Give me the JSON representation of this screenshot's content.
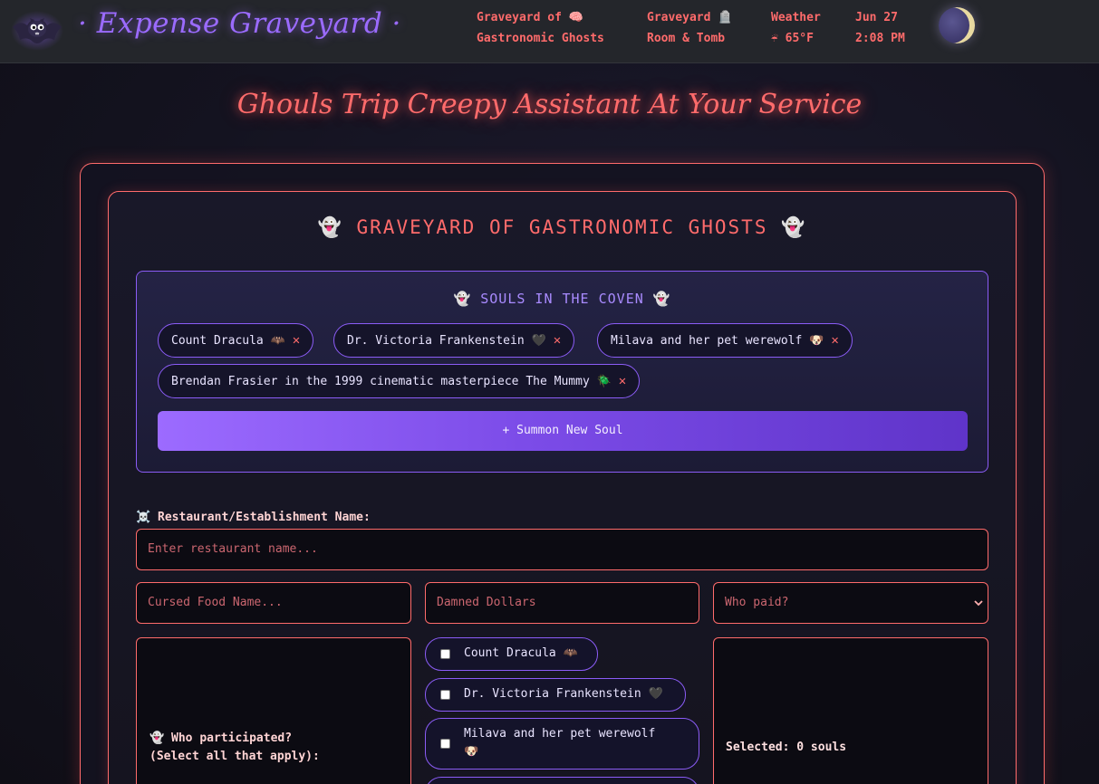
{
  "header": {
    "brand": "· Expense Graveyard ·",
    "nav": [
      {
        "line1": "Graveyard of 🧠",
        "line2": "Gastronomic Ghosts"
      },
      {
        "line1": "Graveyard 🪦",
        "line2": "Room & Tomb"
      }
    ],
    "weather": {
      "label": "Weather",
      "value": "☔ 65°F"
    },
    "datetime": {
      "date": "Jun 27",
      "time": "2:08 PM"
    }
  },
  "hero_title": "Ghouls Trip Creepy Assistant At Your Service",
  "section_title": "👻 GRAVEYARD OF GASTRONOMIC GHOSTS 👻",
  "coven": {
    "title": "👻 SOULS IN THE COVEN 👻",
    "remove_glyph": "✕",
    "members": [
      "Count Dracula 🦇",
      "Dr. Victoria Frankenstein 🖤",
      "Milava and her pet werewolf 🐶",
      "Brendan Frasier in the 1999 cinematic masterpiece The Mummy 🪲"
    ],
    "summon_label": "+ Summon New Soul"
  },
  "form": {
    "restaurant_label": "☠️ Restaurant/Establishment Name:",
    "restaurant_placeholder": "Enter restaurant name...",
    "food_placeholder": "Cursed Food Name...",
    "amount_placeholder": "Damned Dollars",
    "payer_selected": "Who paid?",
    "participants_label_line1": "👻 Who participated?",
    "participants_label_line2": "(Select all that apply):",
    "participant_options": [
      {
        "line1": "Count Dracula 🦇",
        "line2": ""
      },
      {
        "line1": "Dr. Victoria Frankenstein 🖤",
        "line2": ""
      },
      {
        "line1": "Milava and her pet werewolf",
        "line2": "🐶"
      }
    ],
    "selected_text": "Selected: 0 souls"
  }
}
